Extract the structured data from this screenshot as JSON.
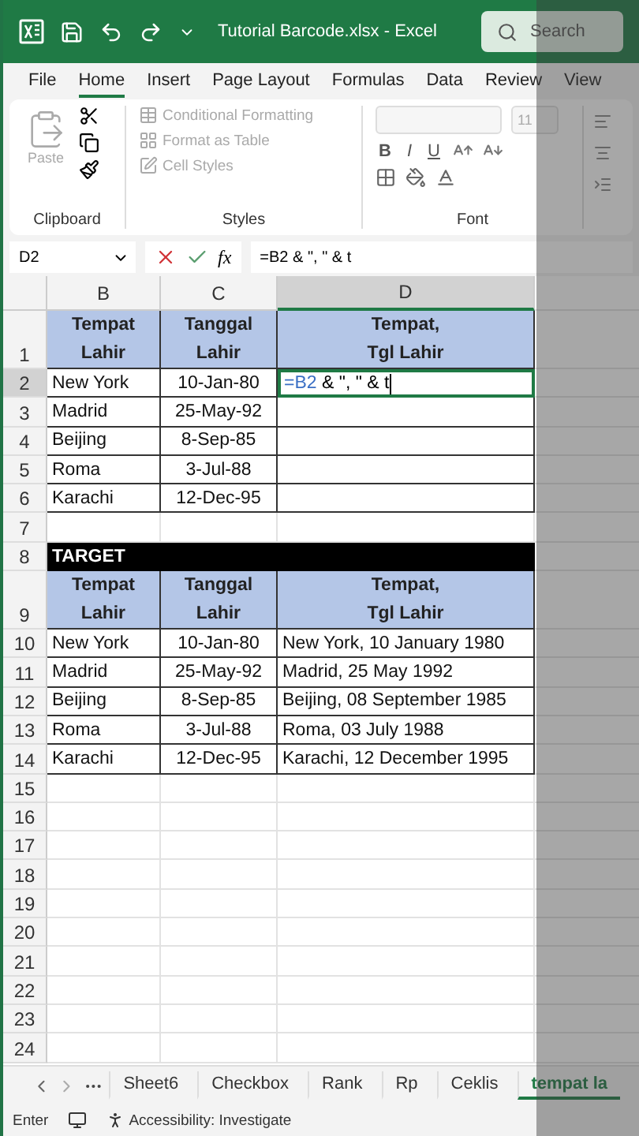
{
  "title_bar": {
    "title": "Tutorial Barcode.xlsx  -  Excel",
    "search": {
      "placeholder": "Search"
    }
  },
  "menu_tabs": [
    {
      "label": "File",
      "selected": false
    },
    {
      "label": "Home",
      "selected": true
    },
    {
      "label": "Insert",
      "selected": false
    },
    {
      "label": "Page Layout",
      "selected": false
    },
    {
      "label": "Formulas",
      "selected": false
    },
    {
      "label": "Data",
      "selected": false
    },
    {
      "label": "Review",
      "selected": false
    },
    {
      "label": "View",
      "selected": false
    }
  ],
  "ribbon": {
    "clipboard": {
      "paste": {
        "label": "Paste",
        "disabled": true
      },
      "group_label": "Clipboard"
    },
    "styles": {
      "items": [
        {
          "label": "Conditional Formatting",
          "disabled": true
        },
        {
          "label": "Format as Table",
          "disabled": true
        },
        {
          "label": "Cell Styles",
          "disabled": true
        }
      ],
      "group_label": "Styles"
    },
    "font": {
      "size": "11",
      "buttons": [
        "B",
        "I",
        "U"
      ],
      "group_label": "Font"
    }
  },
  "formula_bar": {
    "name_box": "D2",
    "function_label": "fx",
    "formula": "=B2 & \", \" & t"
  },
  "columns": [
    {
      "label": "B",
      "selected": false
    },
    {
      "label": "C",
      "selected": false
    },
    {
      "label": "D",
      "selected": true
    }
  ],
  "rows": [
    {
      "num": "1",
      "kind": "header",
      "selected": false,
      "cells": [
        "Tempat\nLahir",
        "Tanggal\nLahir",
        "Tempat,\nTgl Lahir"
      ]
    },
    {
      "num": "2",
      "kind": "data",
      "selected": true,
      "cells": [
        "New York",
        "10-Jan-80"
      ],
      "edit": {
        "ref": "=B2",
        "text": " & \", \" & t"
      }
    },
    {
      "num": "3",
      "kind": "data",
      "selected": false,
      "cells": [
        "Madrid",
        "25-May-92"
      ]
    },
    {
      "num": "4",
      "kind": "data",
      "selected": false,
      "cells": [
        "Beijing",
        "8-Sep-85"
      ]
    },
    {
      "num": "5",
      "kind": "data",
      "selected": false,
      "cells": [
        "Roma",
        "3-Jul-88"
      ]
    },
    {
      "num": "6",
      "kind": "data",
      "selected": false,
      "cells": [
        "Karachi",
        "12-Dec-95"
      ]
    },
    {
      "num": "7",
      "kind": "blank",
      "selected": false
    },
    {
      "num": "8",
      "kind": "banner",
      "selected": false,
      "cells": [
        "TARGET"
      ]
    },
    {
      "num": "9",
      "kind": "header",
      "selected": false,
      "cells": [
        "Tempat\nLahir",
        "Tanggal\nLahir",
        "Tempat,\nTgl Lahir"
      ]
    },
    {
      "num": "10",
      "kind": "data",
      "selected": false,
      "cells": [
        "New York",
        "10-Jan-80",
        "New York, 10 January 1980"
      ]
    },
    {
      "num": "11",
      "kind": "data",
      "selected": false,
      "cells": [
        "Madrid",
        "25-May-92",
        "Madrid, 25 May 1992"
      ]
    },
    {
      "num": "12",
      "kind": "data",
      "selected": false,
      "cells": [
        "Beijing",
        "8-Sep-85",
        "Beijing, 08 September 1985"
      ]
    },
    {
      "num": "13",
      "kind": "data",
      "selected": false,
      "cells": [
        "Roma",
        "3-Jul-88",
        "Roma, 03 July 1988"
      ]
    },
    {
      "num": "14",
      "kind": "data",
      "selected": false,
      "cells": [
        "Karachi",
        "12-Dec-95",
        "Karachi, 12 December 1995"
      ]
    },
    {
      "num": "15",
      "kind": "blank",
      "selected": false
    },
    {
      "num": "16",
      "kind": "blank",
      "selected": false
    },
    {
      "num": "17",
      "kind": "blank",
      "selected": false
    },
    {
      "num": "18",
      "kind": "blank",
      "selected": false
    },
    {
      "num": "19",
      "kind": "blank",
      "selected": false
    },
    {
      "num": "20",
      "kind": "blank",
      "selected": false
    },
    {
      "num": "21",
      "kind": "blank",
      "selected": false
    },
    {
      "num": "22",
      "kind": "blank",
      "selected": false
    },
    {
      "num": "23",
      "kind": "blank",
      "selected": false
    },
    {
      "num": "24",
      "kind": "blank",
      "selected": false
    }
  ],
  "sheet_tabs": [
    {
      "label": "Sheet6",
      "selected": false
    },
    {
      "label": "Checkbox",
      "selected": false
    },
    {
      "label": "Rank",
      "selected": false
    },
    {
      "label": "Rp",
      "selected": false
    },
    {
      "label": "Ceklis",
      "selected": false
    },
    {
      "label": "tempat la",
      "selected": true
    }
  ],
  "status_bar": {
    "mode": "Enter",
    "accessibility": "Accessibility: Investigate"
  }
}
